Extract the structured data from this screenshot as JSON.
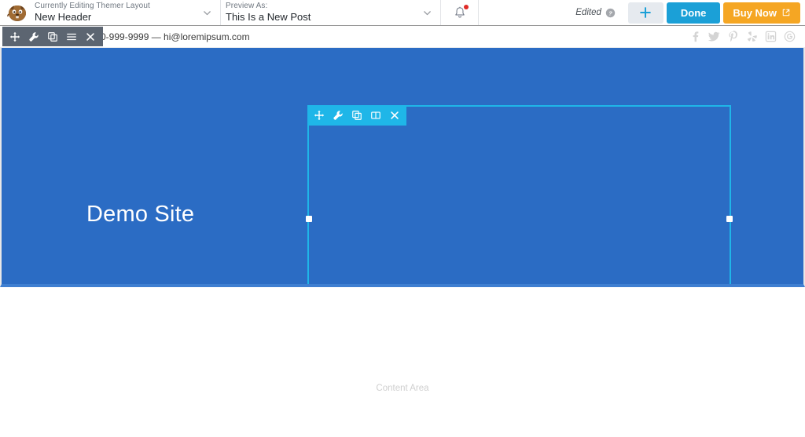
{
  "admin_bar": {
    "logo_icon": "beaver-logo-icon",
    "editing_select": {
      "label": "Currently Editing Themer Layout",
      "value": "New Header",
      "chevron_icon": "chevron-down-icon"
    },
    "preview_select": {
      "label": "Preview As:",
      "value": "This Is a New Post",
      "chevron_icon": "chevron-down-icon"
    },
    "notifications": {
      "icon": "bell-icon",
      "has_unread": true,
      "dot_color": "#e02b27"
    },
    "edited_status": {
      "label": "Edited",
      "help_icon": "help-circle-icon"
    },
    "add_button": {
      "label": "+",
      "icon": "plus-icon",
      "background": "#e6eaef",
      "accent": "#1ba0d7"
    },
    "done_button": {
      "label": "Done",
      "background": "#1ba0d7"
    },
    "buy_button": {
      "label": "Buy Now",
      "icon": "external-link-icon",
      "background": "#f5a623"
    }
  },
  "site_bar": {
    "contact_text": "0-999-9999 — hi@loremipsum.com",
    "social_icons": [
      {
        "name": "facebook-icon",
        "glyph": "f"
      },
      {
        "name": "twitter-icon",
        "glyph": "t"
      },
      {
        "name": "pinterest-icon",
        "glyph": "p"
      },
      {
        "name": "yelp-icon",
        "glyph": "y"
      },
      {
        "name": "linkedin-icon",
        "glyph": "in"
      },
      {
        "name": "googleplus-icon",
        "glyph": "g+"
      }
    ]
  },
  "row_toolbar": {
    "background": "#5c6571",
    "buttons": [
      {
        "name": "move-icon",
        "title": "Move"
      },
      {
        "name": "wrench-icon",
        "title": "Settings"
      },
      {
        "name": "duplicate-icon",
        "title": "Duplicate"
      },
      {
        "name": "menu-icon",
        "title": "Menu"
      },
      {
        "name": "close-icon",
        "title": "Remove"
      }
    ]
  },
  "hero": {
    "background": "#2b6cc4",
    "title": "Demo Site"
  },
  "module_selection": {
    "border_color": "#1fb6e8",
    "toolbar": {
      "buttons": [
        {
          "name": "move-icon",
          "title": "Move"
        },
        {
          "name": "wrench-icon",
          "title": "Settings"
        },
        {
          "name": "duplicate-icon",
          "title": "Duplicate"
        },
        {
          "name": "columns-icon",
          "title": "Column Settings"
        },
        {
          "name": "close-icon",
          "title": "Remove"
        }
      ]
    },
    "handles": [
      {
        "name": "resize-handle-left",
        "position": "left"
      },
      {
        "name": "resize-handle-right",
        "position": "right"
      }
    ]
  },
  "content_area": {
    "label": "Content Area"
  }
}
